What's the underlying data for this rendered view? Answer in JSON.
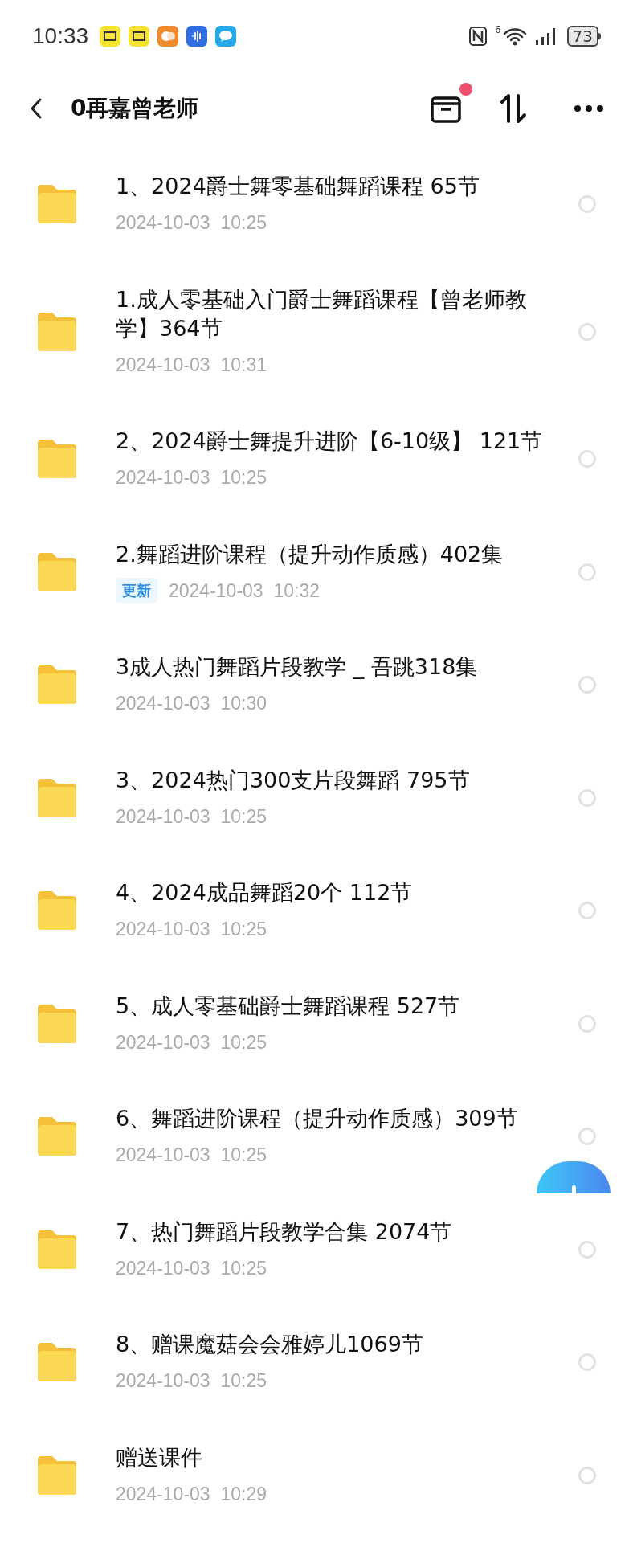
{
  "status_bar": {
    "time": "10:33",
    "network": "6",
    "battery": "73"
  },
  "header": {
    "title": "0再嘉曾老师",
    "notification_dot": true
  },
  "folders": [
    {
      "name": "1、2024爵士舞零基础舞蹈课程  65节",
      "date": "2024-10-03  10:25",
      "selected": false
    },
    {
      "name": "1.成人零基础入门爵士舞蹈课程【曾老师教学】364节",
      "date": "2024-10-03  10:31",
      "selected": false
    },
    {
      "name": "2、2024爵士舞提升进阶【6-10级】 121节",
      "date": "2024-10-03  10:25",
      "selected": false
    },
    {
      "name": "2.舞蹈进阶课程（提升动作质感）402集",
      "badge": "更新",
      "date": "2024-10-03  10:32",
      "selected": false
    },
    {
      "name": "3成人热门舞蹈片段教学 _ 吾跳318集",
      "date": "2024-10-03  10:30",
      "selected": false
    },
    {
      "name": "3、2024热门300支片段舞蹈 795节",
      "date": "2024-10-03  10:25",
      "selected": false
    },
    {
      "name": "4、2024成品舞蹈20个  112节",
      "date": "2024-10-03  10:25",
      "selected": false
    },
    {
      "name": "5、成人零基础爵士舞蹈课程 527节",
      "date": "2024-10-03  10:25",
      "selected": false
    },
    {
      "name": "6、舞蹈进阶课程（提升动作质感）309节",
      "date": "2024-10-03  10:25",
      "selected": false,
      "fab_behind": true
    },
    {
      "name": "7、热门舞蹈片段教学合集 2074节",
      "date": "2024-10-03  10:25",
      "selected": false
    },
    {
      "name": "8、赠课魔菇会会雅婷儿1069节",
      "date": "2024-10-03  10:25",
      "selected": false
    },
    {
      "name": "赠送课件",
      "date": "2024-10-03  10:29",
      "selected": false
    }
  ]
}
